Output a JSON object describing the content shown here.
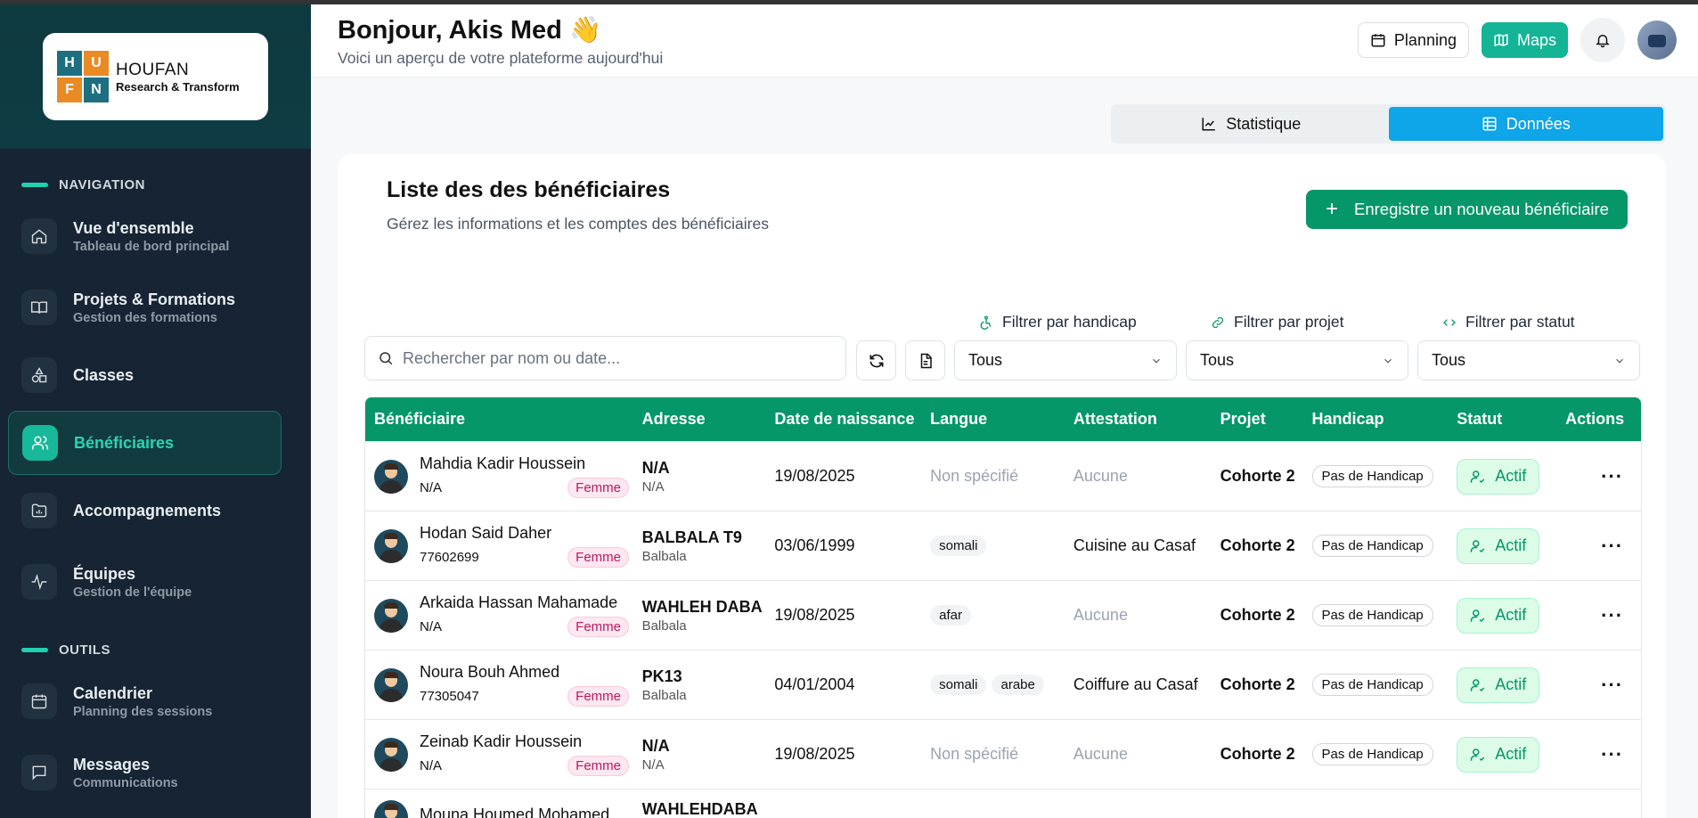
{
  "logo": {
    "letters": [
      "H",
      "U",
      "F",
      "N"
    ],
    "name": "HOUFAN",
    "tagline": "Research & Transform"
  },
  "sidebar": {
    "sections": [
      {
        "title": "NAVIGATION",
        "items": [
          {
            "label": "Vue d'ensemble",
            "sub": "Tableau de bord principal",
            "icon": "home-icon"
          },
          {
            "label": "Projets & Formations",
            "sub": "Gestion des formations",
            "icon": "book-icon"
          },
          {
            "label": "Classes",
            "sub": "",
            "icon": "shapes-icon"
          },
          {
            "label": "Bénéficiaires",
            "sub": "",
            "icon": "users-icon",
            "active": true
          },
          {
            "label": "Accompagnements",
            "sub": "",
            "icon": "folder-chart-icon"
          },
          {
            "label": "Équipes",
            "sub": "Gestion de l'équipe",
            "icon": "activity-icon"
          }
        ]
      },
      {
        "title": "OUTILS",
        "items": [
          {
            "label": "Calendrier",
            "sub": "Planning des sessions",
            "icon": "calendar-icon"
          },
          {
            "label": "Messages",
            "sub": "Communications",
            "icon": "message-icon"
          }
        ]
      }
    ]
  },
  "header": {
    "greeting": "Bonjour, Akis Med 👋",
    "subtitle": "Voici un aperçu de votre plateforme aujourd'hui",
    "planning_label": "Planning",
    "maps_label": "Maps"
  },
  "view_toggle": {
    "stats_label": "Statistique",
    "data_label": "Données",
    "selected": "Données"
  },
  "list": {
    "title": "Liste des des bénéficiaires",
    "subtitle": "Gérez les informations et les comptes des bénéficiaires",
    "new_button": "Enregistre un nouveau bénéficiaire",
    "search_placeholder": "Rechercher par nom ou date...",
    "filters": [
      {
        "label": "Filtrer par handicap",
        "value": "Tous"
      },
      {
        "label": "Filtrer par projet",
        "value": "Tous"
      },
      {
        "label": "Filtrer par statut",
        "value": "Tous"
      }
    ]
  },
  "table": {
    "columns": [
      "Bénéficiaire",
      "Adresse",
      "Date de naissance",
      "Langue",
      "Attestation",
      "Projet",
      "Handicap",
      "Statut",
      "Actions"
    ],
    "rows": [
      {
        "name": "Mahdia Kadir Houssein",
        "phone": "N/A",
        "gender": "Femme",
        "addr1": "N/A",
        "addr2": "N/A",
        "dob": "19/08/2025",
        "langues": [],
        "langue_empty": "Non spécifié",
        "attestation": "Aucune",
        "attest_empty": true,
        "projet": "Cohorte 2",
        "handicap": "Pas de Handicap",
        "statut": "Actif"
      },
      {
        "name": "Hodan Said Daher",
        "phone": "77602699",
        "gender": "Femme",
        "addr1": "BALBALA T9",
        "addr2": "Balbala",
        "dob": "03/06/1999",
        "langues": [
          "somali"
        ],
        "langue_empty": "",
        "attestation": "Cuisine au Casaf",
        "attest_empty": false,
        "projet": "Cohorte 2",
        "handicap": "Pas de Handicap",
        "statut": "Actif"
      },
      {
        "name": "Arkaida Hassan Mahamade",
        "phone": "N/A",
        "gender": "Femme",
        "addr1": "WAHLEH DABA",
        "addr2": "Balbala",
        "dob": "19/08/2025",
        "langues": [
          "afar"
        ],
        "langue_empty": "",
        "attestation": "Aucune",
        "attest_empty": true,
        "projet": "Cohorte 2",
        "handicap": "Pas de Handicap",
        "statut": "Actif"
      },
      {
        "name": "Noura Bouh Ahmed",
        "phone": "77305047",
        "gender": "Femme",
        "addr1": "PK13",
        "addr2": "Balbala",
        "dob": "04/01/2004",
        "langues": [
          "somali",
          "arabe"
        ],
        "langue_empty": "",
        "attestation": "Coiffure au Casaf",
        "attest_empty": false,
        "projet": "Cohorte 2",
        "handicap": "Pas de Handicap",
        "statut": "Actif"
      },
      {
        "name": "Zeinab Kadir Houssein",
        "phone": "N/A",
        "gender": "Femme",
        "addr1": "N/A",
        "addr2": "N/A",
        "dob": "19/08/2025",
        "langues": [],
        "langue_empty": "Non spécifié",
        "attestation": "Aucune",
        "attest_empty": true,
        "projet": "Cohorte 2",
        "handicap": "Pas de Handicap",
        "statut": "Actif"
      },
      {
        "name": "Mouna Houmed Mohamed",
        "phone": "",
        "gender": "",
        "addr1": "WAHLEHDABA",
        "addr2": "",
        "dob": "",
        "langues": [],
        "langue_empty": "",
        "attestation": "",
        "attest_empty": false,
        "projet": "",
        "handicap": "",
        "statut": ""
      }
    ]
  },
  "colors": {
    "sidebar_bg": "#162433",
    "accent_teal": "#13b596",
    "table_header": "#059669",
    "toggle_active": "#0ea5e9"
  }
}
